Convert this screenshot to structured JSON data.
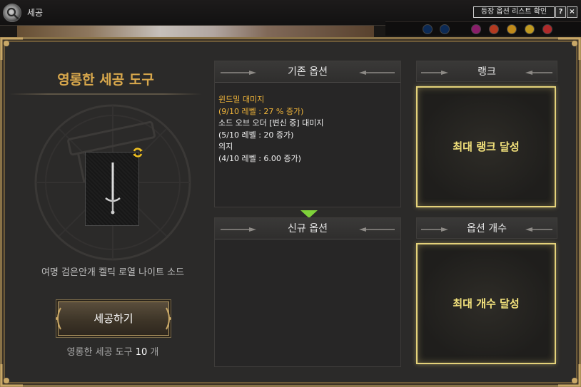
{
  "window": {
    "title": "세공",
    "equip_list_button": "등장 옵션 리스트 확인",
    "help_label": "?",
    "close_label": "×"
  },
  "left": {
    "tool_name": "영롱한 세공 도구",
    "item_name": "여명 검은안개 켈틱 로열 나이트 소드",
    "craft_button": "세공하기",
    "tool_count_prefix": "영롱한 세공 도구",
    "tool_count_value": "10",
    "tool_count_suffix": "개"
  },
  "existing_options": {
    "header": "기존 옵션",
    "lines": [
      {
        "text": "윈드밀 대미지",
        "highlight": true
      },
      {
        "text": "(9/10 레벨 : 27 % 증가)",
        "highlight": true
      },
      {
        "text": "소드 오브 오더 [변신 중] 대미지",
        "highlight": false
      },
      {
        "text": "(5/10 레벨 : 20 증가)",
        "highlight": false
      },
      {
        "text": "의지",
        "highlight": false
      },
      {
        "text": "(4/10 레벨 : 6.00 증가)",
        "highlight": false
      }
    ]
  },
  "new_options": {
    "header": "신규 옵션"
  },
  "rank": {
    "header": "랭크",
    "status": "최대 랭크 달성"
  },
  "option_count": {
    "header": "옵션 개수",
    "status": "최대 개수 달성"
  },
  "colors": {
    "gold_text": "#d9a84c",
    "highlight_text": "#f2b63a",
    "goal_border": "#e4d27a",
    "arrow_green": "#7fd23a"
  },
  "icons": [
    "search-logo-icon",
    "help-icon",
    "close-icon",
    "swap-icon",
    "sword-icon",
    "down-arrow-icon"
  ]
}
